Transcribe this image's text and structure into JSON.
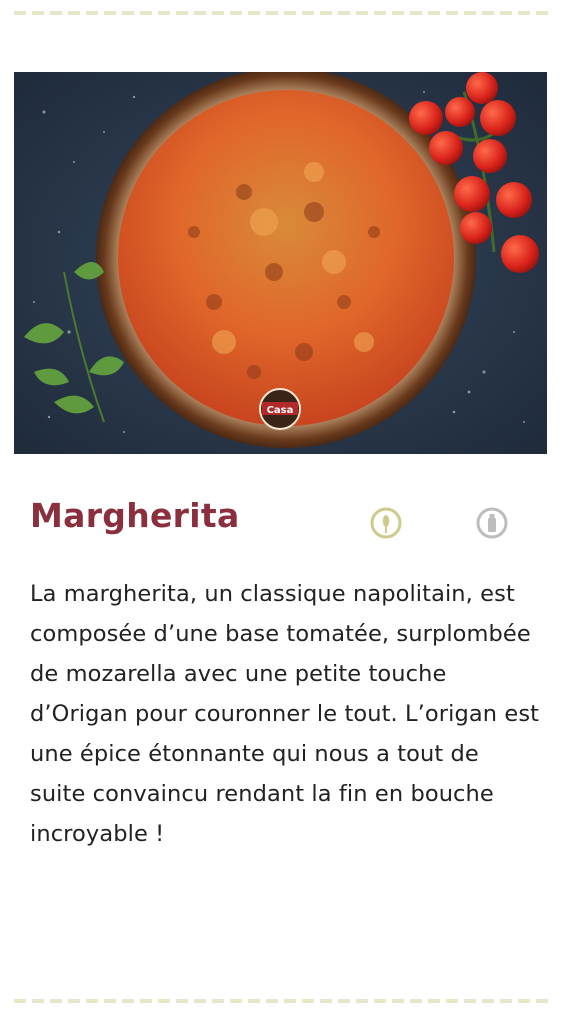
{
  "product": {
    "name": "Margherita",
    "description": "La margherita, un classique napolitain, est composée d’une base tomatée, surplombée de mozarella avec une petite touche d’Origan pour couronner le tout. L’origan est une épice étonnante qui nous a tout de suite convaincu rendant la fin en bouche incroyable !",
    "image": {
      "logo_text": "Casa"
    },
    "diet_icons": [
      "wheat-badge-icon",
      "bottle-badge-icon"
    ]
  },
  "colors": {
    "title": "#8b2f3f",
    "dash_border": "#e7e6c9",
    "background": "#ffffff",
    "text": "#222222",
    "veg_icon": "#cfc98c",
    "lactose_icon": "#bdbdbd"
  }
}
